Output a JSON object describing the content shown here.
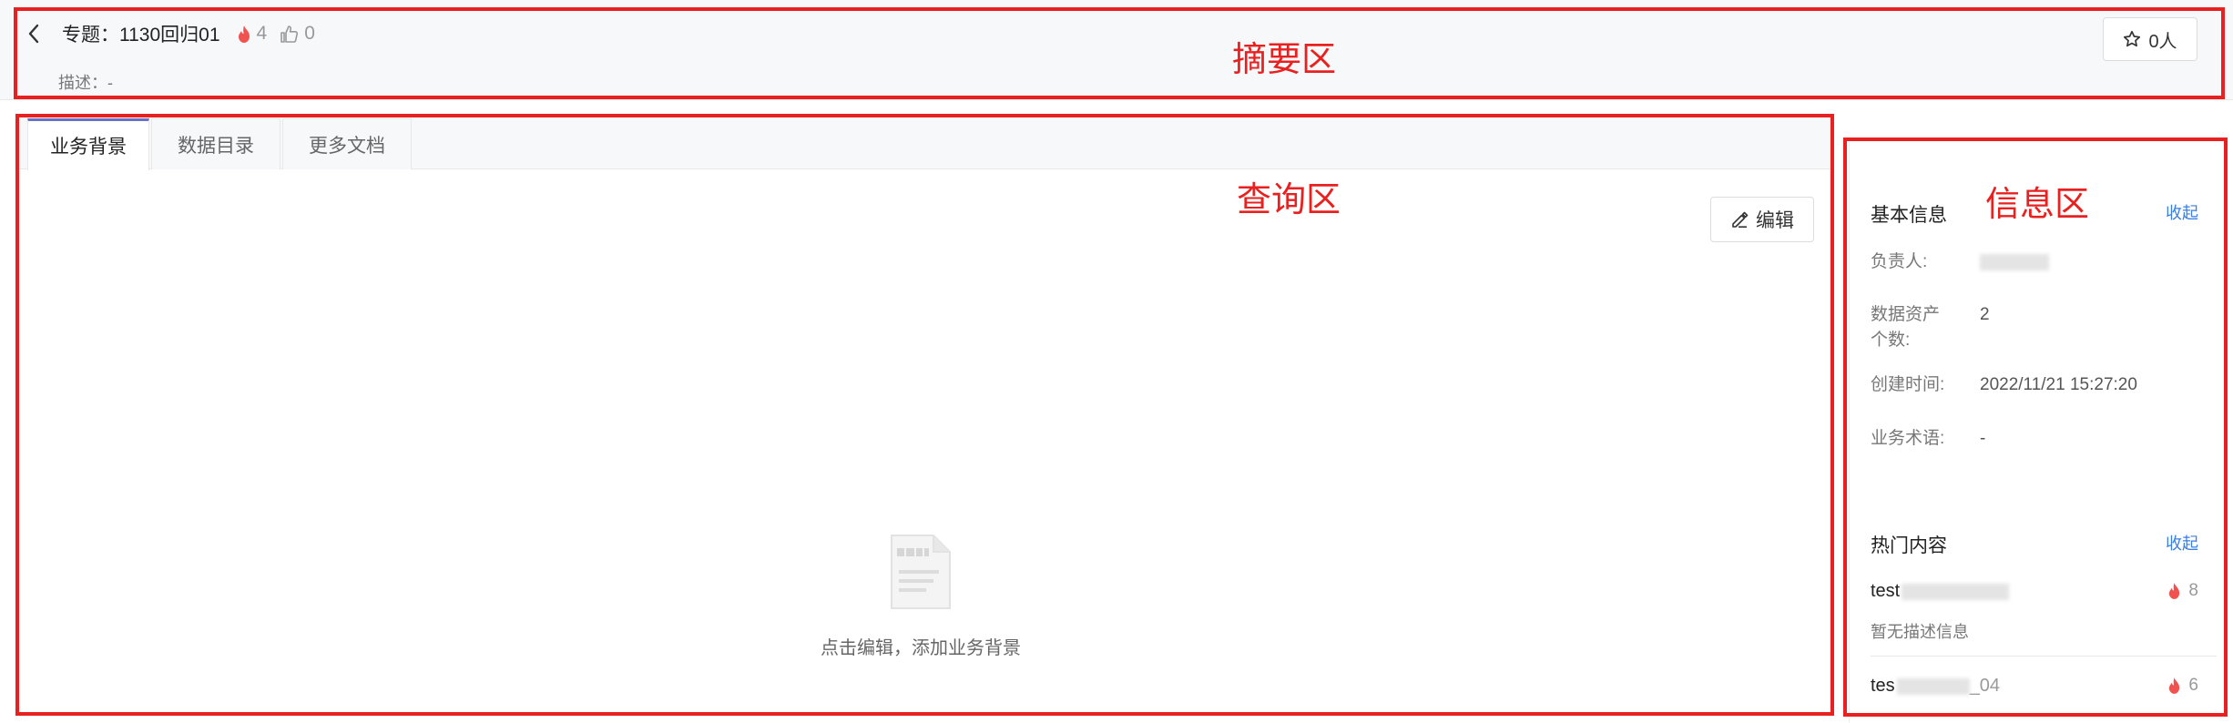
{
  "summary": {
    "back_icon": "chevron-left-icon",
    "title_prefix": "专题：",
    "title": "1130回归01",
    "hot_count": "4",
    "like_count": "0",
    "description": "描述：-",
    "follow_label": "0人"
  },
  "tabs": [
    {
      "label": "业务背景",
      "active": true
    },
    {
      "label": "数据目录",
      "active": false
    },
    {
      "label": "更多文档",
      "active": false
    }
  ],
  "query": {
    "edit_label": "编辑",
    "empty_text": "点击编辑，添加业务背景"
  },
  "info": {
    "basic_title": "基本信息",
    "collapse_label": "收起",
    "fields": [
      {
        "label": "负责人:",
        "value": ""
      },
      {
        "label": "数据资产\n个数:",
        "value": "2"
      },
      {
        "label": "创建时间:",
        "value": "2022/11/21 15:27:20"
      },
      {
        "label": "业务术语:",
        "value": "-"
      }
    ],
    "hot_title": "热门内容",
    "hot_collapse_label": "收起",
    "hot_items": [
      {
        "name": "test",
        "count": "8",
        "desc": "暂无描述信息"
      },
      {
        "name": "tes",
        "name_suffix": "_04",
        "count": "6"
      }
    ]
  },
  "annotations": {
    "summary_zone": "摘要区",
    "query_zone": "查询区",
    "info_zone": "信息区",
    "color": "#e8201f"
  },
  "colors": {
    "accent_blue": "#3a7ee0",
    "hot_red": "#f0524f",
    "tab_active_border": "#6b70c4"
  }
}
